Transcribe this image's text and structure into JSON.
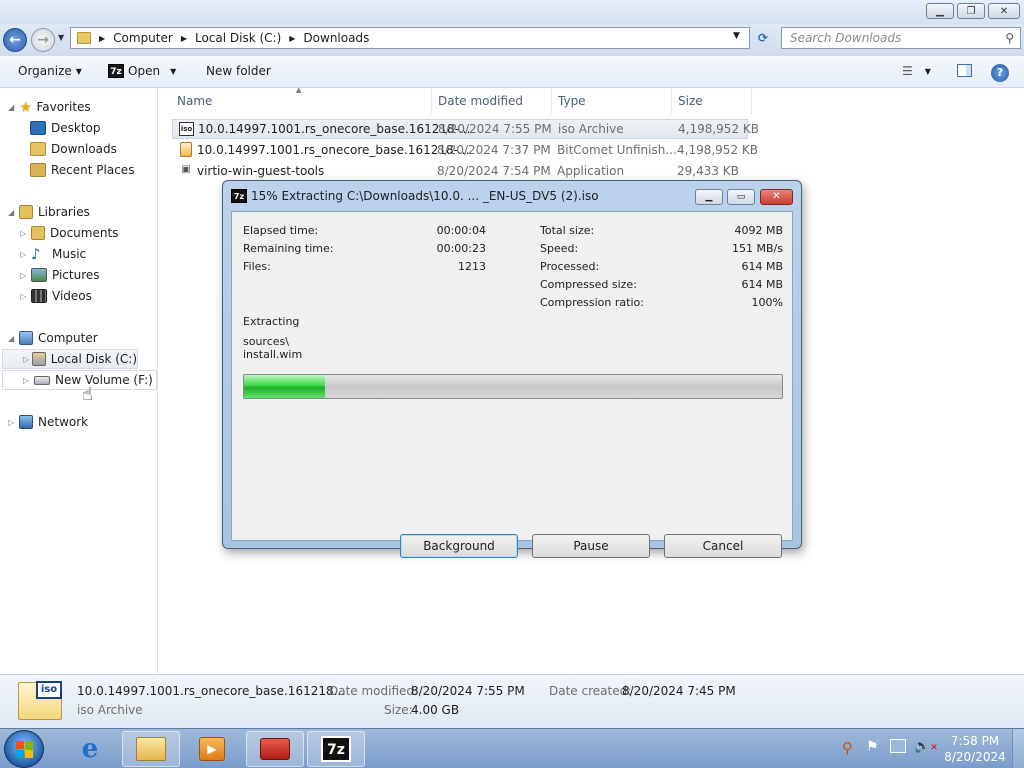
{
  "window": {
    "caption_buttons": [
      "minimize",
      "restore",
      "close"
    ]
  },
  "address": {
    "breadcrumbs": [
      "Computer",
      "Local Disk (C:)",
      "Downloads"
    ],
    "search_placeholder": "Search Downloads"
  },
  "toolbar": {
    "organize": "Organize",
    "open": "Open",
    "new_folder": "New folder"
  },
  "nav": {
    "favorites": "Favorites",
    "desktop": "Desktop",
    "downloads": "Downloads",
    "recent": "Recent Places",
    "libraries": "Libraries",
    "documents": "Documents",
    "music": "Music",
    "pictures": "Pictures",
    "videos": "Videos",
    "computer": "Computer",
    "local_disk": "Local Disk (C:)",
    "new_volume": "New Volume (F:)",
    "network": "Network"
  },
  "columns": {
    "name": "Name",
    "date": "Date modified",
    "type": "Type",
    "size": "Size"
  },
  "files": [
    {
      "name": "10.0.14997.1001.rs_onecore_base.161218-...",
      "date": "8/20/2024 7:55 PM",
      "type": "iso Archive",
      "size": "4,198,952 KB"
    },
    {
      "name": "10.0.14997.1001.rs_onecore_base.161218-...",
      "date": "8/20/2024 7:37 PM",
      "type": "BitComet Unfinish...",
      "size": "4,198,952 KB"
    },
    {
      "name": "virtio-win-guest-tools",
      "date": "8/20/2024 7:54 PM",
      "type": "Application",
      "size": "29,433 KB"
    }
  ],
  "dialog": {
    "title": "15% Extracting C:\\Downloads\\10.0. ... _EN-US_DV5 (2).iso",
    "elapsed_label": "Elapsed time:",
    "elapsed": "00:00:04",
    "remaining_label": "Remaining time:",
    "remaining": "00:00:23",
    "files_label": "Files:",
    "files": "1213",
    "total_label": "Total size:",
    "total": "4092 MB",
    "speed_label": "Speed:",
    "speed": "151 MB/s",
    "processed_label": "Processed:",
    "processed": "614 MB",
    "compressed_label": "Compressed size:",
    "compressed": "614 MB",
    "ratio_label": "Compression ratio:",
    "ratio": "100%",
    "extracting_label": "Extracting",
    "path_line1": "sources\\",
    "path_line2": "install.wim",
    "progress": 0.15,
    "background": "Background",
    "pause": "Pause",
    "cancel": "Cancel"
  },
  "details": {
    "filename": "10.0.14997.1001.rs_onecore_base.161218...",
    "type": "iso Archive",
    "modified_label": "Date modified:",
    "modified": "8/20/2024 7:55 PM",
    "created_label": "Date created:",
    "created": "8/20/2024 7:45 PM",
    "size_label": "Size:",
    "size": "4.00 GB",
    "icon_text": "iso"
  },
  "taskbar": {
    "time": "7:58 PM",
    "date": "8/20/2024",
    "sevenzip_label": "7z"
  },
  "colors": {
    "progress_fill": "#2ecc40",
    "close_red": "#c8402f"
  }
}
